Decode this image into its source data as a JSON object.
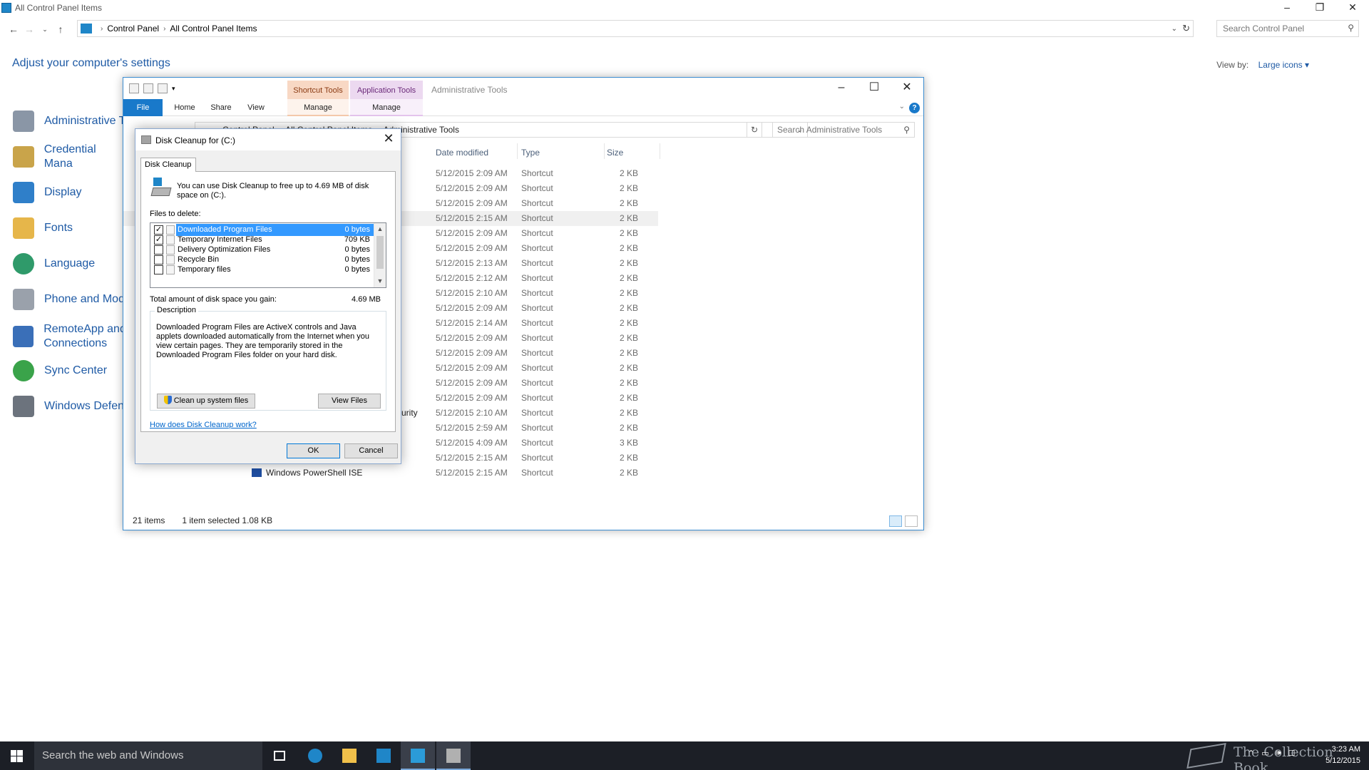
{
  "control_panel": {
    "window_title": "All Control Panel Items",
    "window_buttons": [
      "–",
      "❐",
      "✕"
    ],
    "breadcrumbs": [
      "Control Panel",
      "All Control Panel Items"
    ],
    "search_placeholder": "Search Control Panel",
    "heading": "Adjust your computer's settings",
    "view_by_label": "View by:",
    "view_by_value": "Large icons ▾",
    "items": [
      {
        "label": "Administrative T",
        "icon": "admin-tools-icon"
      },
      {
        "label": "Credential Mana",
        "icon": "credential-manager-icon"
      },
      {
        "label": "Display",
        "icon": "display-icon"
      },
      {
        "label": "Fonts",
        "icon": "fonts-icon"
      },
      {
        "label": "Language",
        "icon": "language-icon"
      },
      {
        "label": "Phone and Mod",
        "icon": "phone-modem-icon"
      },
      {
        "label": "RemoteApp and Connections",
        "icon": "remoteapp-icon"
      },
      {
        "label": "Sync Center",
        "icon": "sync-center-icon"
      },
      {
        "label": "Windows Defen",
        "icon": "windows-defender-icon"
      }
    ]
  },
  "explorer": {
    "title": "Administrative Tools",
    "context_tabs": [
      "Shortcut Tools",
      "Application Tools"
    ],
    "ribbon_tabs": [
      "File",
      "Home",
      "Share",
      "View",
      "Manage",
      "Manage"
    ],
    "breadcrumbs": [
      "Control Panel",
      "All Control Panel Items",
      "Administrative Tools"
    ],
    "search_placeholder": "Search Administrative Tools",
    "columns": [
      "Date modified",
      "Type",
      "Size"
    ],
    "rows": [
      {
        "name": "",
        "date": "5/12/2015 2:09 AM",
        "type": "Shortcut",
        "size": "2 KB"
      },
      {
        "name": "",
        "date": "5/12/2015 2:09 AM",
        "type": "Shortcut",
        "size": "2 KB"
      },
      {
        "name": "",
        "date": "5/12/2015 2:09 AM",
        "type": "Shortcut",
        "size": "2 KB"
      },
      {
        "name": "",
        "date": "5/12/2015 2:15 AM",
        "type": "Shortcut",
        "size": "2 KB"
      },
      {
        "name": "",
        "date": "5/12/2015 2:09 AM",
        "type": "Shortcut",
        "size": "2 KB"
      },
      {
        "name": "",
        "date": "5/12/2015 2:09 AM",
        "type": "Shortcut",
        "size": "2 KB"
      },
      {
        "name": "",
        "date": "5/12/2015 2:13 AM",
        "type": "Shortcut",
        "size": "2 KB"
      },
      {
        "name": "",
        "date": "5/12/2015 2:12 AM",
        "type": "Shortcut",
        "size": "2 KB"
      },
      {
        "name": "",
        "date": "5/12/2015 2:10 AM",
        "type": "Shortcut",
        "size": "2 KB"
      },
      {
        "name": "",
        "date": "5/12/2015 2:09 AM",
        "type": "Shortcut",
        "size": "2 KB"
      },
      {
        "name": "",
        "date": "5/12/2015 2:14 AM",
        "type": "Shortcut",
        "size": "2 KB"
      },
      {
        "name": "",
        "date": "5/12/2015 2:09 AM",
        "type": "Shortcut",
        "size": "2 KB"
      },
      {
        "name": "",
        "date": "5/12/2015 2:09 AM",
        "type": "Shortcut",
        "size": "2 KB"
      },
      {
        "name": "",
        "date": "5/12/2015 2:09 AM",
        "type": "Shortcut",
        "size": "2 KB"
      },
      {
        "name": "",
        "date": "5/12/2015 2:09 AM",
        "type": "Shortcut",
        "size": "2 KB"
      },
      {
        "name": "",
        "date": "5/12/2015 2:09 AM",
        "type": "Shortcut",
        "size": "2 KB"
      },
      {
        "name": "urity",
        "date": "5/12/2015 2:10 AM",
        "type": "Shortcut",
        "size": "2 KB"
      },
      {
        "name": "",
        "date": "5/12/2015 2:59 AM",
        "type": "Shortcut",
        "size": "2 KB"
      },
      {
        "name": "",
        "date": "5/12/2015 4:09 AM",
        "type": "Shortcut",
        "size": "3 KB"
      },
      {
        "name": "",
        "date": "5/12/2015 2:15 AM",
        "type": "Shortcut",
        "size": "2 KB"
      },
      {
        "name": "Windows PowerShell ISE",
        "date": "5/12/2015 2:15 AM",
        "type": "Shortcut",
        "size": "2 KB"
      }
    ],
    "status_count": "21 items",
    "status_selected": "1 item selected  1.08 KB"
  },
  "disk_cleanup": {
    "title": "Disk Cleanup for  (C:)",
    "tab": "Disk Cleanup",
    "intro": "You can use Disk Cleanup to free up to 4.69 MB of disk space on  (C:).",
    "files_label": "Files to delete:",
    "files": [
      {
        "name": "Downloaded Program Files",
        "size": "0 bytes",
        "checked": true,
        "selected": true
      },
      {
        "name": "Temporary Internet Files",
        "size": "709 KB",
        "checked": true,
        "selected": false
      },
      {
        "name": "Delivery Optimization Files",
        "size": "0 bytes",
        "checked": false,
        "selected": false
      },
      {
        "name": "Recycle Bin",
        "size": "0 bytes",
        "checked": false,
        "selected": false
      },
      {
        "name": "Temporary files",
        "size": "0 bytes",
        "checked": false,
        "selected": false
      }
    ],
    "total_label": "Total amount of disk space you gain:",
    "total_value": "4.69 MB",
    "description_legend": "Description",
    "description": "Downloaded Program Files are ActiveX controls and Java applets downloaded automatically from the Internet when you view certain pages. They are temporarily stored in the Downloaded Program Files folder on your hard disk.",
    "cleanup_button": "Clean up system files",
    "view_files_button": "View Files",
    "help_link": "How does Disk Cleanup work?",
    "ok_button": "OK",
    "cancel_button": "Cancel"
  },
  "taskbar": {
    "search_placeholder": "Search the web and Windows",
    "watermark": "The Collection Book",
    "time": "3:23 AM",
    "date": "5/12/2015"
  }
}
